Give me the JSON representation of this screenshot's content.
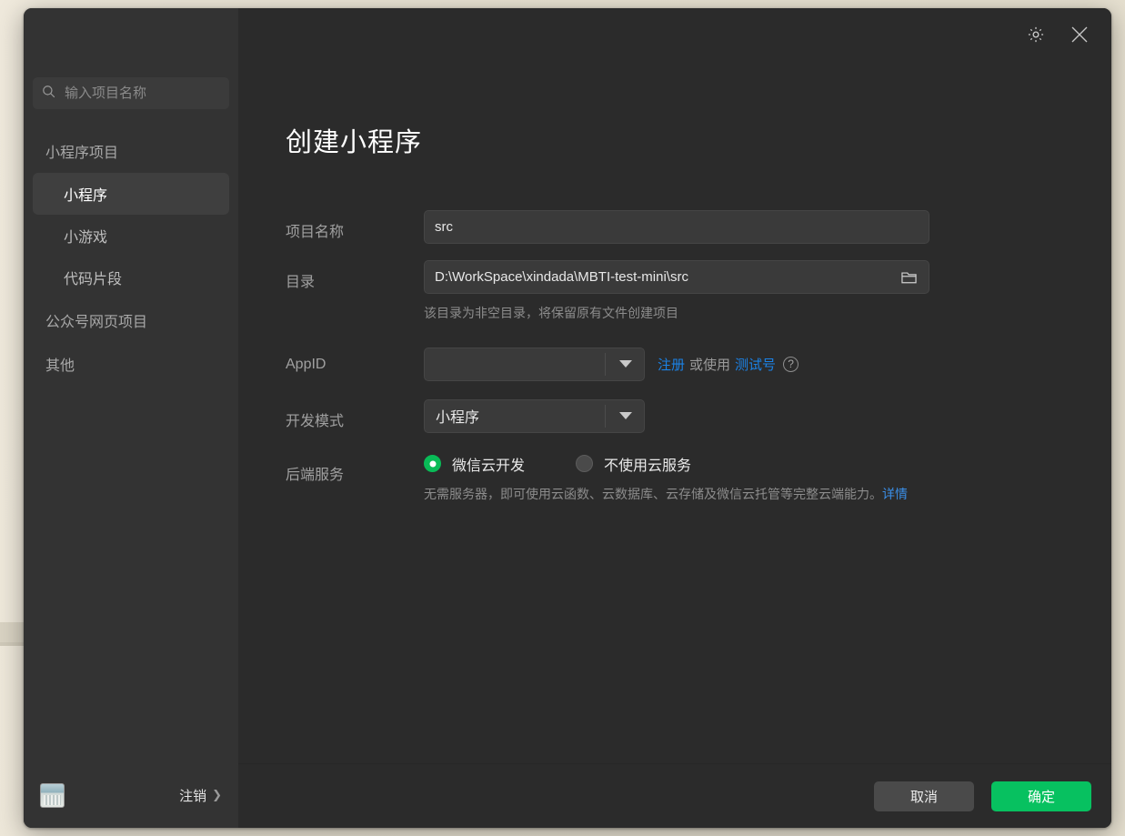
{
  "window": {
    "titlebar": {
      "settings_icon": "gear-icon",
      "close_icon": "close-icon"
    }
  },
  "sidebar": {
    "search": {
      "icon": "search-icon",
      "value": "",
      "placeholder": "输入项目名称"
    },
    "groups": [
      {
        "label": "小程序项目",
        "items": [
          {
            "label": "小程序",
            "active": true
          },
          {
            "label": "小游戏",
            "active": false
          },
          {
            "label": "代码片段",
            "active": false
          }
        ]
      }
    ],
    "top_items": [
      {
        "label": "公众号网页项目"
      },
      {
        "label": "其他"
      }
    ],
    "footer": {
      "avatar": "user-avatar",
      "logout_label": "注销",
      "logout_chevron": "chevron-right-icon"
    }
  },
  "main": {
    "title": "创建小程序",
    "form": {
      "project_name": {
        "label": "项目名称",
        "value": "src"
      },
      "directory": {
        "label": "目录",
        "value": "D:\\WorkSpace\\xindada\\MBTI-test-mini\\src",
        "browse_icon": "folder-icon",
        "hint": "该目录为非空目录，将保留原有文件创建项目"
      },
      "appid": {
        "label": "AppID",
        "value": "",
        "caret_icon": "chevron-down-icon",
        "register_link": "注册",
        "or_text": "或使用",
        "test_link": "测试号",
        "help_icon": "help-circle-icon"
      },
      "dev_mode": {
        "label": "开发模式",
        "value": "小程序",
        "caret_icon": "chevron-down-icon"
      },
      "backend": {
        "label": "后端服务",
        "options": [
          {
            "label": "微信云开发",
            "checked": true
          },
          {
            "label": "不使用云服务",
            "checked": false
          }
        ],
        "hint_text": "无需服务器，即可使用云函数、云数据库、云存储及微信云托管等完整云端能力。",
        "hint_link": "详情"
      }
    }
  },
  "footer": {
    "cancel_label": "取消",
    "confirm_label": "确定"
  },
  "colors": {
    "accent_green": "#07c160",
    "radio_green": "#09bb57",
    "link_blue": "#1b82e6",
    "window_bg": "#2b2b2b",
    "sidebar_bg": "#333333"
  }
}
